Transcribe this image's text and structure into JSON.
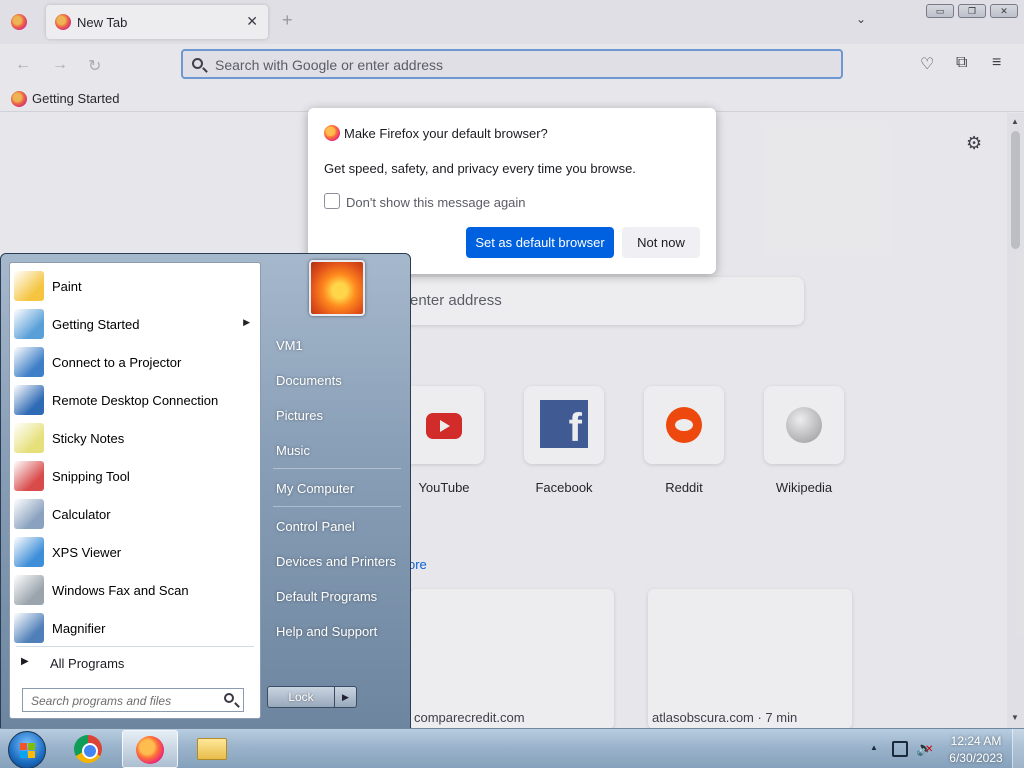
{
  "browser": {
    "tab_title": "New Tab",
    "new_tab_glyph": "+",
    "url_placeholder": "Search with Google or enter address",
    "bookmark": "Getting Started",
    "content_search_placeholder": "enter address",
    "top_sites": [
      "YouTube",
      "Facebook",
      "Reddit",
      "Wikipedia"
    ],
    "more_link": "ore",
    "stories": [
      "comparecredit.com",
      "atlasobscura.com · 7 min"
    ]
  },
  "dialog": {
    "title": "Make Firefox your default browser?",
    "body": "Get speed, safety, and privacy every time you browse.",
    "checkbox_label": "Don't show this message again",
    "primary_button": "Set as default browser",
    "secondary_button": "Not now"
  },
  "start_menu": {
    "programs": [
      {
        "label": "Paint",
        "icon": "paint-icon",
        "color": "#f5c542"
      },
      {
        "label": "Getting Started",
        "icon": "getting-started-icon",
        "color": "#5aa0d8",
        "submenu": true
      },
      {
        "label": "Connect to a Projector",
        "icon": "projector-icon",
        "color": "#3f7fc7"
      },
      {
        "label": "Remote Desktop Connection",
        "icon": "remote-desktop-icon",
        "color": "#2f6bb5"
      },
      {
        "label": "Sticky Notes",
        "icon": "sticky-notes-icon",
        "color": "#e6e07a"
      },
      {
        "label": "Snipping Tool",
        "icon": "snipping-tool-icon",
        "color": "#d94b4b"
      },
      {
        "label": "Calculator",
        "icon": "calculator-icon",
        "color": "#8aa2bf"
      },
      {
        "label": "XPS Viewer",
        "icon": "xps-viewer-icon",
        "color": "#3f8fd8"
      },
      {
        "label": "Windows Fax and Scan",
        "icon": "fax-scan-icon",
        "color": "#9aa4ad"
      },
      {
        "label": "Magnifier",
        "icon": "magnifier-icon",
        "color": "#4f7fb8"
      }
    ],
    "all_programs": "All Programs",
    "search_placeholder": "Search programs and files",
    "right_items": {
      "group1": [
        "VM1",
        "Documents",
        "Pictures",
        "Music"
      ],
      "group2": [
        "My Computer"
      ],
      "group3": [
        "Control Panel",
        "Devices and Printers",
        "Default Programs",
        "Help and Support"
      ]
    },
    "lock_label": "Lock"
  },
  "taskbar": {
    "time": "12:24 AM",
    "date": "6/30/2023"
  }
}
